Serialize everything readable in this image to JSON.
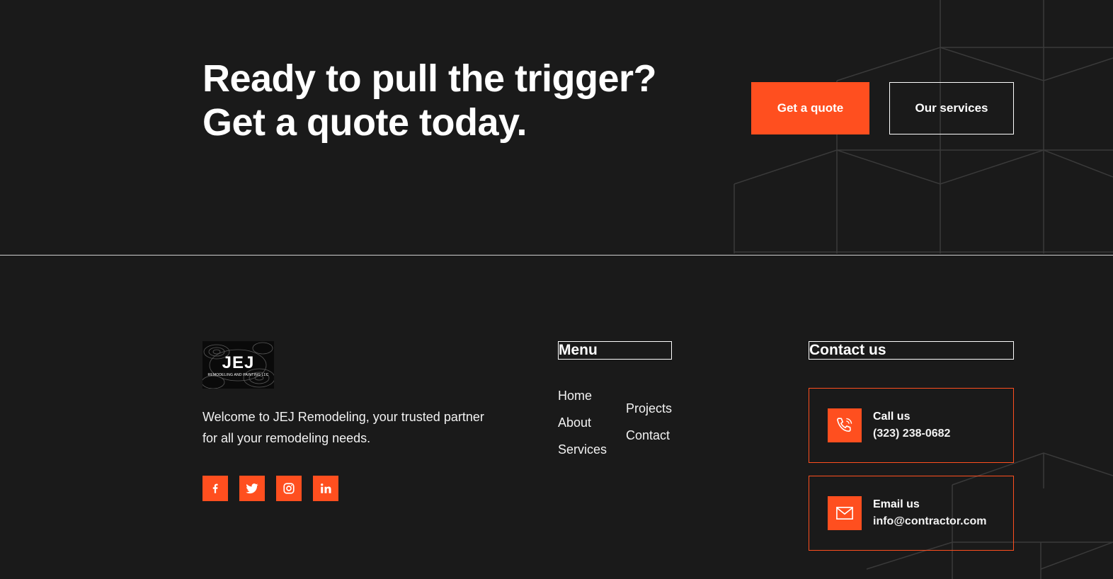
{
  "cta": {
    "heading_line1": "Ready to pull the trigger?",
    "heading_line2": "Get a quote today.",
    "primary_button": "Get a quote",
    "secondary_button": "Our services"
  },
  "brand": {
    "logo_title": "JEJ",
    "logo_subtitle": "REMODELING AND PAINTING LLC",
    "welcome_text": "Welcome to JEJ Remodeling, your trusted partner for all your remodeling needs."
  },
  "socials": [
    {
      "name": "facebook",
      "icon": "facebook-icon"
    },
    {
      "name": "twitter",
      "icon": "twitter-icon"
    },
    {
      "name": "instagram",
      "icon": "instagram-icon"
    },
    {
      "name": "linkedin",
      "icon": "linkedin-icon"
    }
  ],
  "menu": {
    "title": "Menu",
    "items": [
      "Home",
      "About",
      "Services",
      "Projects",
      "Contact"
    ]
  },
  "contact": {
    "title": "Contact us",
    "call_label": "Call us",
    "call_value": "(323) 238-0682",
    "email_label": "Email us",
    "email_value": "info@contractor.com"
  },
  "colors": {
    "background": "#1a1a1a",
    "accent": "#ff4f1f",
    "text": "#ffffff"
  }
}
